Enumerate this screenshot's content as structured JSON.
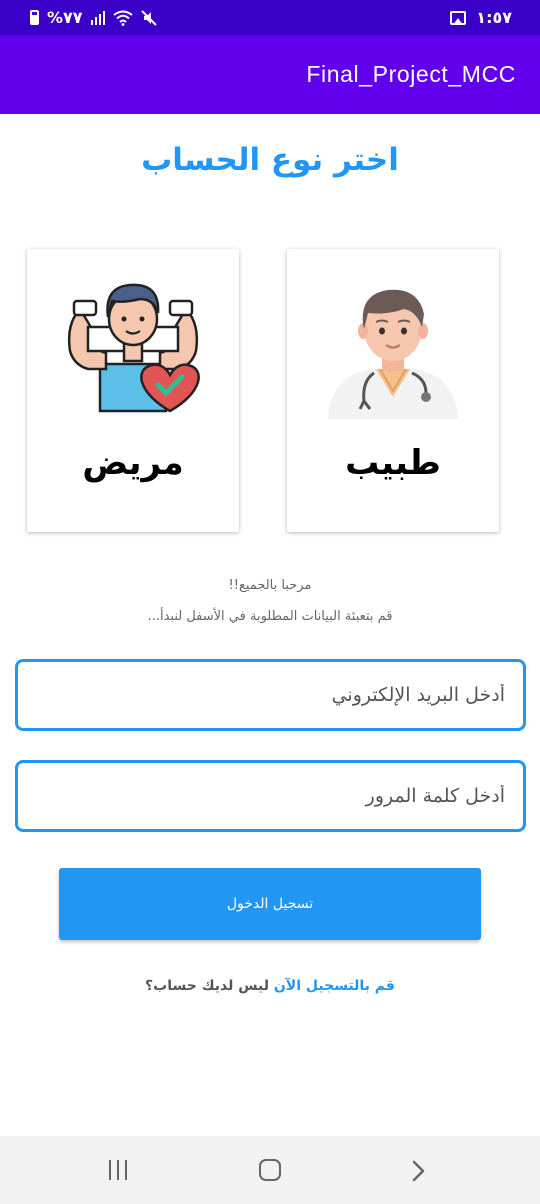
{
  "status_bar": {
    "battery_text": "%٧٧",
    "time": "١:٥٧"
  },
  "app_bar": {
    "title": "Final_Project_MCC"
  },
  "main": {
    "title": "اختر نوع الحساب",
    "account_types": [
      {
        "label": "طبيب",
        "icon": "doctor-avatar"
      },
      {
        "label": "مريض",
        "icon": "patient-avatar"
      }
    ],
    "welcome_line1": "مرحبا بالجميع!!",
    "welcome_line2": "قم بتعبئة البيانات المطلوبة في الأسفل لنبدأ...",
    "email_placeholder": "أدخل البريد الإلكتروني",
    "password_placeholder": "أدخل كلمة المرور",
    "login_label": "تسجيل الدخول",
    "register_link": "قم بالتسجيل الآن",
    "register_prompt": "ليس لديك حساب؟"
  },
  "colors": {
    "status_bar": "#3a00c8",
    "app_bar": "#6200ee",
    "accent": "#2196f3"
  }
}
